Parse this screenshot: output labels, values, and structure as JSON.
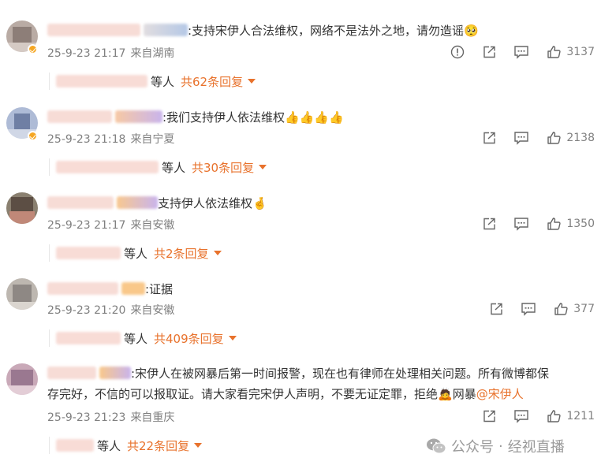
{
  "comments": [
    {
      "text": ":支持宋伊人合法维权，网络不是法外之地，请勿造谣",
      "emoji": "🥺",
      "date": "25-9-23 21:17",
      "location": "来自湖南",
      "likes": "3137",
      "reply_suffix": "等人",
      "reply_total": "共62条回复",
      "has_report": true
    },
    {
      "text": ":我们支持伊人依法维权",
      "emoji": "👍👍👍👍",
      "date": "25-9-23 21:18",
      "location": "来自宁夏",
      "likes": "2138",
      "reply_suffix": "等人",
      "reply_total": "共30条回复"
    },
    {
      "text": "支持伊人依法维权",
      "emoji": "🤞",
      "date": "25-9-23 21:17",
      "location": "来自安徽",
      "likes": "1350",
      "reply_suffix": "等人",
      "reply_total": "共2条回复"
    },
    {
      "text": ":证据",
      "date": "25-9-23 21:20",
      "location": "来自安徽",
      "likes": "377",
      "reply_suffix": "等人",
      "reply_total": "共409条回复"
    },
    {
      "text_line1": ":宋伊人在被网暴后第一时间报警，现在也有律师在处理相关问题。所有微博都保",
      "text_line2": "存完好，不信的可以报取证。请大家看完宋伊人声明，不要无证定罪，拒绝",
      "emoji": "🙇",
      "text_tail": "网暴",
      "mention": "@宋伊人",
      "date": "25-9-23 21:23",
      "location": "来自重庆",
      "likes": "1211",
      "reply_suffix": "等人",
      "reply_total": "共22条回复"
    }
  ],
  "watermark": {
    "label": "公众号",
    "name": "经视直播"
  },
  "colors": {
    "accent": "#e8722c",
    "meta": "#808080"
  }
}
